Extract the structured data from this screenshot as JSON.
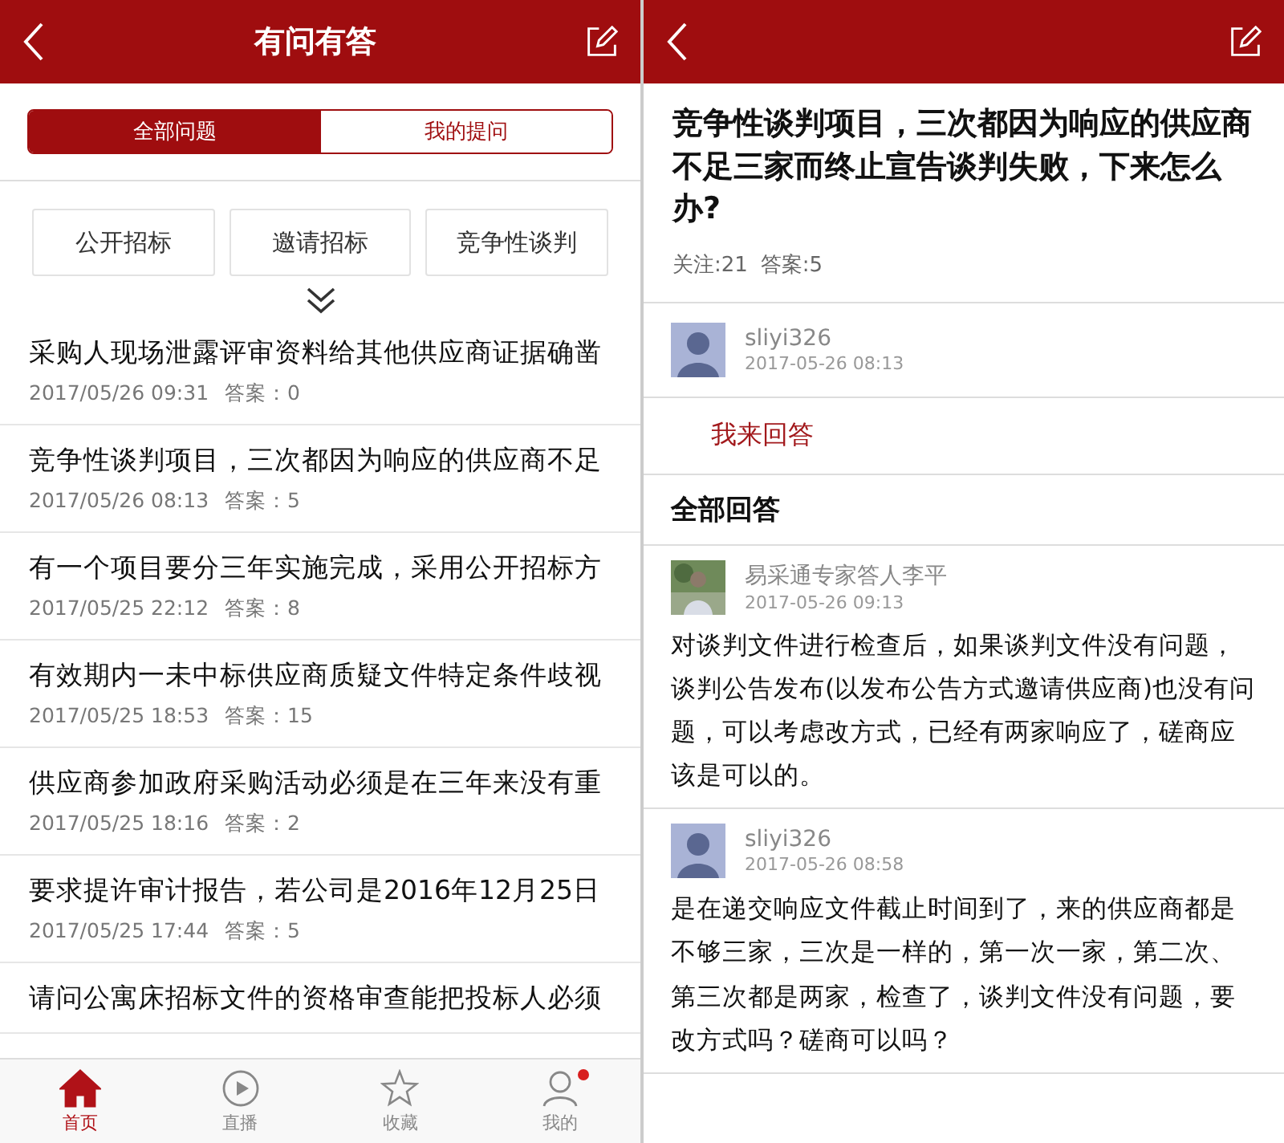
{
  "list_screen": {
    "header": {
      "title": "有问有答"
    },
    "segments": [
      {
        "label": "全部问题",
        "selected": true
      },
      {
        "label": "我的提问",
        "selected": false
      }
    ],
    "categories": [
      "公开招标",
      "邀请招标",
      "竞争性谈判"
    ],
    "questions": [
      {
        "title": "采购人现场泄露评审资料给其他供应商证据确凿",
        "time": "2017/05/26 09:31",
        "answers": "答案：0"
      },
      {
        "title": "竞争性谈判项目，三次都因为响应的供应商不足",
        "time": "2017/05/26 08:13",
        "answers": "答案：5"
      },
      {
        "title": "有一个项目要分三年实施完成，采用公开招标方",
        "time": "2017/05/25 22:12",
        "answers": "答案：8"
      },
      {
        "title": "有效期内一未中标供应商质疑文件特定条件歧视",
        "time": "2017/05/25 18:53",
        "answers": "答案：15"
      },
      {
        "title": "供应商参加政府采购活动必须是在三年来没有重",
        "time": "2017/05/25 18:16",
        "answers": "答案：2"
      },
      {
        "title": "要求提许审计报告，若公司是2016年12月25日",
        "time": "2017/05/25 17:44",
        "answers": "答案：5"
      },
      {
        "title": "请问公寓床招标文件的资格审查能把投标人必须"
      }
    ],
    "tab_bar": [
      {
        "label": "首页",
        "kind": "home",
        "selected": true
      },
      {
        "label": "直播",
        "kind": "play",
        "selected": false
      },
      {
        "label": "收藏",
        "kind": "star",
        "selected": false
      },
      {
        "label": "我的",
        "kind": "user",
        "selected": false,
        "dot": true
      }
    ]
  },
  "detail_screen": {
    "question": {
      "title": "竞争性谈判项目，三次都因为响应的供应商不足三家而终止宣告谈判失败，下来怎么办?",
      "followers": "关注:21",
      "answers": "答案:5"
    },
    "asker": {
      "name": "sliyi326",
      "time": "2017-05-26 08:13",
      "kind": "default"
    },
    "answer_link": "我来回答",
    "answers_heading": "全部回答",
    "answers": [
      {
        "name": "易采通专家答人李平",
        "time": "2017-05-26 09:13",
        "body": "对谈判文件进行检查后，如果谈判文件没有问题，谈判公告发布(以发布公告方式邀请供应商)也没有问题，可以考虑改方式，已经有两家响应了，磋商应该是可以的。"
      },
      {
        "name": "sliyi326",
        "time": "2017-05-26 08:58",
        "kind": "default",
        "body": "是在递交响应文件截止时间到了，来的供应商都是不够三家，三次是一样的，第一次一家，第二次、第三次都是两家，检查了，谈判文件没有问题，要改方式吗？磋商可以吗？"
      }
    ]
  }
}
